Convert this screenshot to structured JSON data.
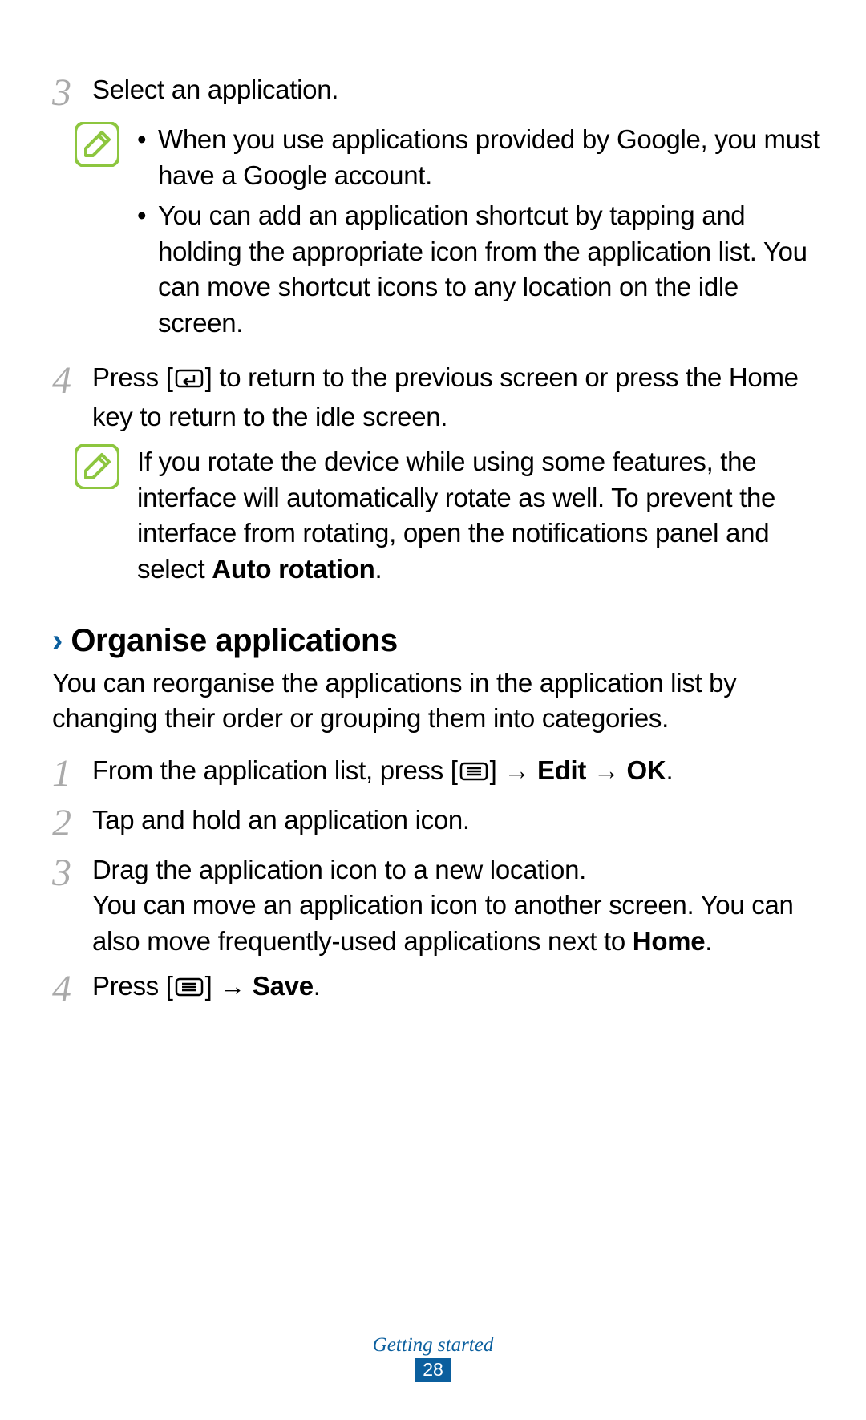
{
  "step3": {
    "num": "3",
    "text": "Select an application."
  },
  "note1": {
    "bullet1": "When you use applications provided by Google, you must have a Google account.",
    "bullet2": "You can add an application shortcut by tapping and holding the appropriate icon from the application list. You can move shortcut icons to any location on the idle screen."
  },
  "step4a": {
    "num": "4",
    "pre": "Press [",
    "post": "] to return to the previous screen or press the Home key to return to the idle screen."
  },
  "note2": {
    "text_pre": "If you rotate the device while using some features, the interface will automatically rotate as well. To prevent the interface from rotating, open the notifications panel and select ",
    "bold": "Auto rotation",
    "text_post": "."
  },
  "section": {
    "title": "Organise applications",
    "intro": "You can reorganise the applications in the application list by changing their order or grouping them into categories."
  },
  "org1": {
    "num": "1",
    "pre": "From the application list, press [",
    "mid": "] ",
    "arrow1": "→",
    "edit": " Edit ",
    "arrow2": "→",
    "ok": " OK",
    "post": "."
  },
  "org2": {
    "num": "2",
    "text": "Tap and hold an application icon."
  },
  "org3": {
    "num": "3",
    "line1": "Drag the application icon to a new location.",
    "line2_pre": "You can move an application icon to another screen. You can also move frequently-used applications next to ",
    "home": "Home",
    "line2_post": "."
  },
  "org4": {
    "num": "4",
    "pre": "Press [",
    "mid": "] ",
    "arrow": "→",
    "save": " Save",
    "post": "."
  },
  "footer": {
    "label": "Getting started",
    "page": "28"
  }
}
